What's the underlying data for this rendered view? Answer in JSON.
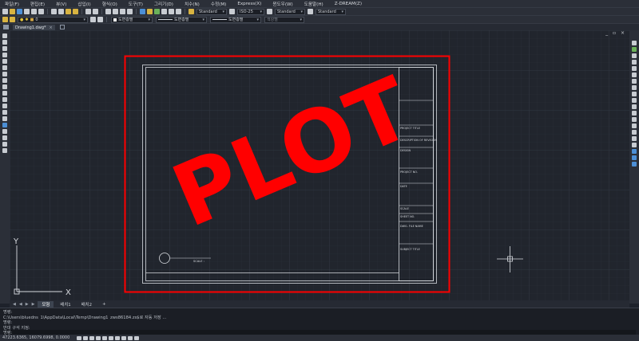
{
  "menu": [
    "파일(F)",
    "편집(E)",
    "뷰(V)",
    "삽입(I)",
    "형식(O)",
    "도구(T)",
    "그리기(D)",
    "치수(N)",
    "수정(M)",
    "Express(X)",
    "윈도우(W)",
    "도움말(H)",
    "Z-DREAM(Z)"
  ],
  "toolbar": {
    "text_style": "Standard",
    "dim_style": "ISO-25",
    "table_style": "Standard",
    "multileader_style": "Standard",
    "layer": "0",
    "color": "도면층별",
    "linetype": "도면층별",
    "lineweight": "도면층별",
    "plotstyle": "색상별"
  },
  "tabs": {
    "document": "Drawing1.dwg*",
    "close": "×"
  },
  "viewport_controls": "_ ▫ ×",
  "drawing": {
    "stamp_text": "PLOT",
    "accent_red": "#ff0000",
    "title_block": [
      "PROJECT TITLE",
      "DESCRIPTION OF REVISION",
      "DESIGN",
      "PROJECT NO.",
      "DATE",
      "SCALE",
      "SHEET NO.",
      "DWG. FILE NAME",
      "SUBJECT TITLE"
    ],
    "scale_label": "SCALE :",
    "ucs": {
      "x": "X",
      "y": "Y"
    }
  },
  "layout_tabs": {
    "nav": [
      "◀",
      "◀",
      "▶",
      "▶"
    ],
    "tabs": [
      "모형",
      "배치1",
      "배치2"
    ],
    "active": "모형",
    "add": "+"
  },
  "command": {
    "lines": [
      "명령:",
      "C:\\Users\\bluedns_1\\AppData\\Local\\Temp\\Drawing1_zws86184.zs$로 자동 저장 ...",
      "명령:",
      "반대 구석 지정:"
    ],
    "prompt": "명령:"
  },
  "status": {
    "coords": "47223.6365, 16079.6998, 0.0000"
  }
}
